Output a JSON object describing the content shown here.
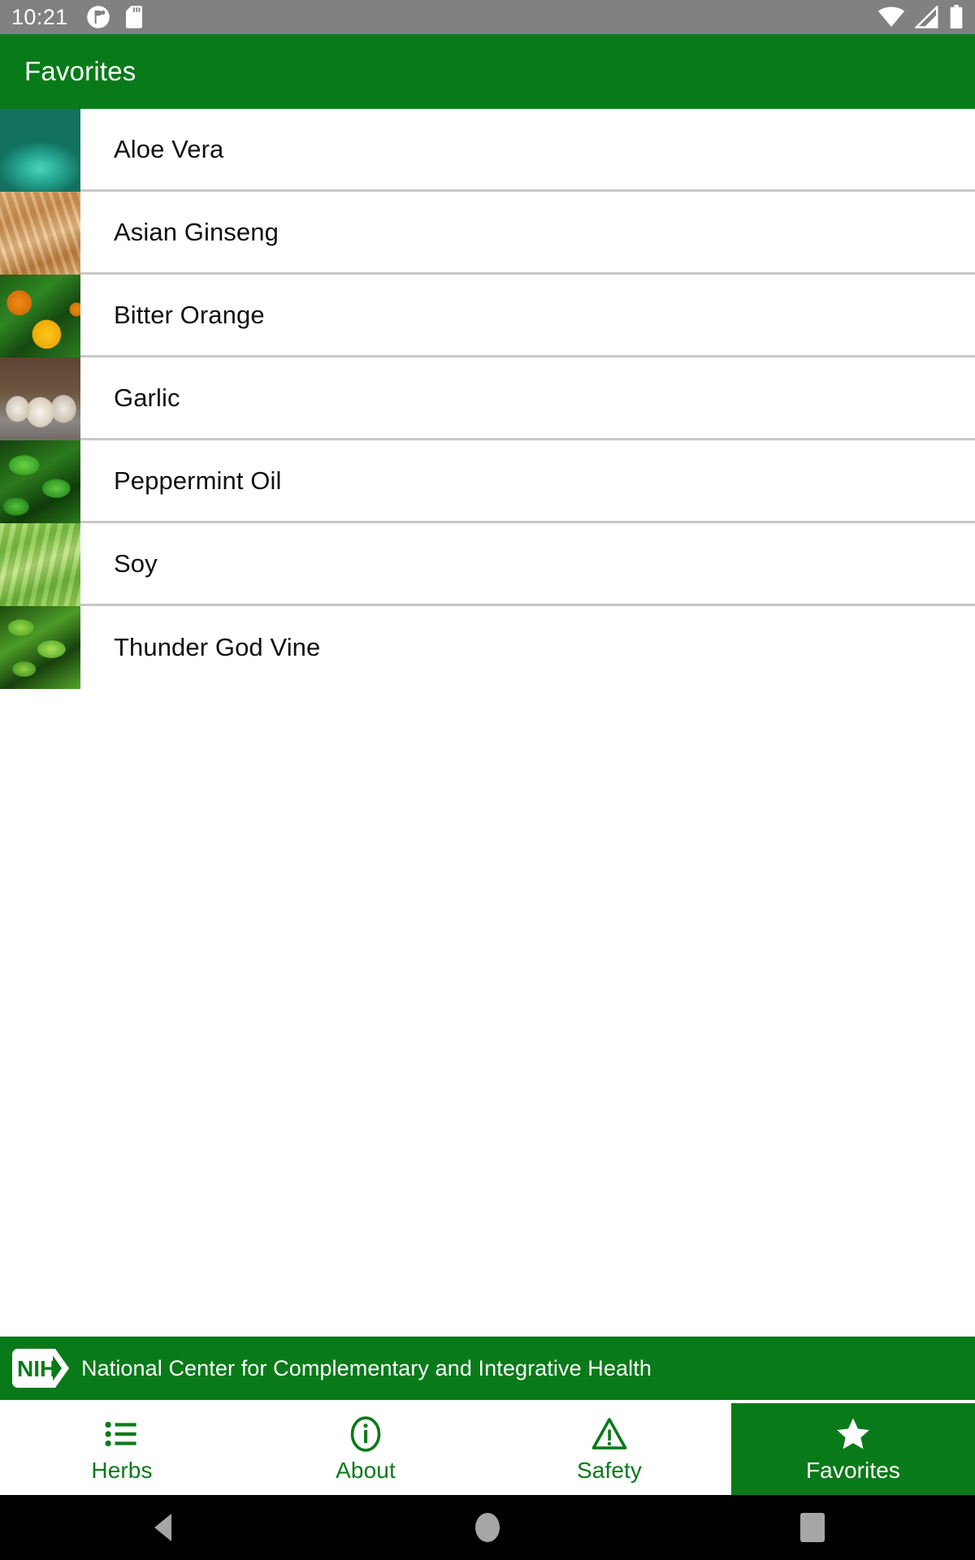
{
  "status_bar": {
    "time": "10:21",
    "left_icons": [
      "app-notification-icon",
      "sd-card-icon"
    ],
    "right_icons": [
      "wifi-icon",
      "cellular-signal-icon",
      "battery-icon"
    ]
  },
  "app_bar": {
    "title": "Favorites",
    "background_color": "#097a19",
    "text_color": "#ffffff"
  },
  "favorites_list": {
    "items": [
      {
        "name": "Aloe Vera",
        "thumbnail": "aloe-vera-photo"
      },
      {
        "name": "Asian Ginseng",
        "thumbnail": "asian-ginseng-photo"
      },
      {
        "name": "Bitter Orange",
        "thumbnail": "bitter-orange-photo"
      },
      {
        "name": "Garlic",
        "thumbnail": "garlic-photo"
      },
      {
        "name": "Peppermint Oil",
        "thumbnail": "peppermint-oil-photo"
      },
      {
        "name": "Soy",
        "thumbnail": "soy-photo"
      },
      {
        "name": "Thunder God Vine",
        "thumbnail": "thunder-god-vine-photo"
      }
    ]
  },
  "footer_banner": {
    "logo_text": "NIH",
    "agency_name": "National Center for Complementary and Integrative Health",
    "background_color": "#097a19"
  },
  "tab_bar": {
    "active_index": 3,
    "active_color": "#097a19",
    "inactive_text_color": "#0a7a1a",
    "tabs": [
      {
        "label": "Herbs",
        "icon": "list-icon"
      },
      {
        "label": "About",
        "icon": "info-circle-icon"
      },
      {
        "label": "Safety",
        "icon": "warning-triangle-icon"
      },
      {
        "label": "Favorites",
        "icon": "star-icon"
      }
    ]
  },
  "system_nav": {
    "buttons": [
      {
        "name": "back",
        "icon": "triangle-back-icon"
      },
      {
        "name": "home",
        "icon": "circle-home-icon"
      },
      {
        "name": "recents",
        "icon": "square-recents-icon"
      }
    ]
  }
}
